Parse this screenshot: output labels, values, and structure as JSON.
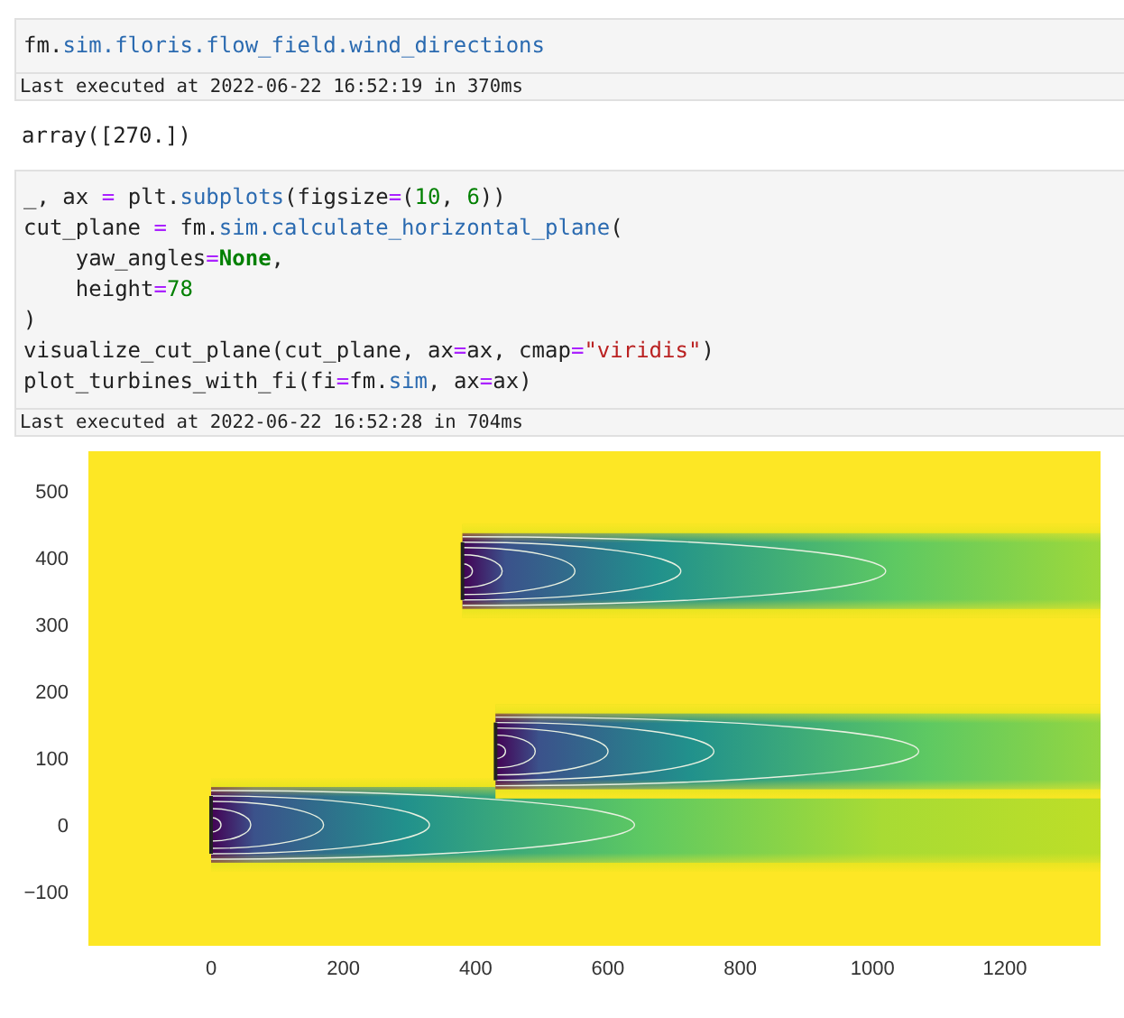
{
  "cells": [
    {
      "code": [
        [
          {
            "text": "fm.",
            "kind": "plain"
          },
          {
            "text": "sim.floris.flow_field.wind_directions",
            "kind": "attribute"
          }
        ]
      ],
      "executed": "Last executed at 2022-06-22 16:52:19 in 370ms",
      "output": "array([270.])"
    },
    {
      "code": [
        [
          {
            "text": "_, ax ",
            "kind": "plain"
          },
          {
            "text": "=",
            "kind": "operator"
          },
          {
            "text": " plt.",
            "kind": "plain"
          },
          {
            "text": "subplots",
            "kind": "attribute"
          },
          {
            "text": "(figsize",
            "kind": "plain"
          },
          {
            "text": "=",
            "kind": "operator"
          },
          {
            "text": "(",
            "kind": "plain"
          },
          {
            "text": "10",
            "kind": "number"
          },
          {
            "text": ", ",
            "kind": "plain"
          },
          {
            "text": "6",
            "kind": "number"
          },
          {
            "text": "))",
            "kind": "plain"
          }
        ],
        [
          {
            "text": "cut_plane ",
            "kind": "plain"
          },
          {
            "text": "=",
            "kind": "operator"
          },
          {
            "text": " fm.",
            "kind": "plain"
          },
          {
            "text": "sim.calculate_horizontal_plane",
            "kind": "attribute"
          },
          {
            "text": "(",
            "kind": "plain"
          }
        ],
        [
          {
            "text": "    yaw_angles",
            "kind": "plain"
          },
          {
            "text": "=",
            "kind": "operator"
          },
          {
            "text": "None",
            "kind": "keyword"
          },
          {
            "text": ",",
            "kind": "plain"
          }
        ],
        [
          {
            "text": "    height",
            "kind": "plain"
          },
          {
            "text": "=",
            "kind": "operator"
          },
          {
            "text": "78",
            "kind": "number"
          }
        ],
        [
          {
            "text": ")",
            "kind": "plain"
          }
        ],
        [
          {
            "text": "visualize_cut_plane(cut_plane, ax",
            "kind": "plain"
          },
          {
            "text": "=",
            "kind": "operator"
          },
          {
            "text": "ax, cmap",
            "kind": "plain"
          },
          {
            "text": "=",
            "kind": "operator"
          },
          {
            "text": "\"viridis\"",
            "kind": "string"
          },
          {
            "text": ")",
            "kind": "plain"
          }
        ],
        [
          {
            "text": "plot_turbines_with_fi(fi",
            "kind": "plain"
          },
          {
            "text": "=",
            "kind": "operator"
          },
          {
            "text": "fm.",
            "kind": "plain"
          },
          {
            "text": "sim",
            "kind": "attribute"
          },
          {
            "text": ", ax",
            "kind": "plain"
          },
          {
            "text": "=",
            "kind": "operator"
          },
          {
            "text": "ax)",
            "kind": "plain"
          }
        ]
      ],
      "executed": "Last executed at 2022-06-22 16:52:28 in 704ms",
      "plot": {
        "yticks": [
          "500",
          "400",
          "300",
          "200",
          "100",
          "0",
          "−100"
        ],
        "xticks": [
          "0",
          "200",
          "400",
          "600",
          "800",
          "1000",
          "1200"
        ]
      }
    }
  ]
}
